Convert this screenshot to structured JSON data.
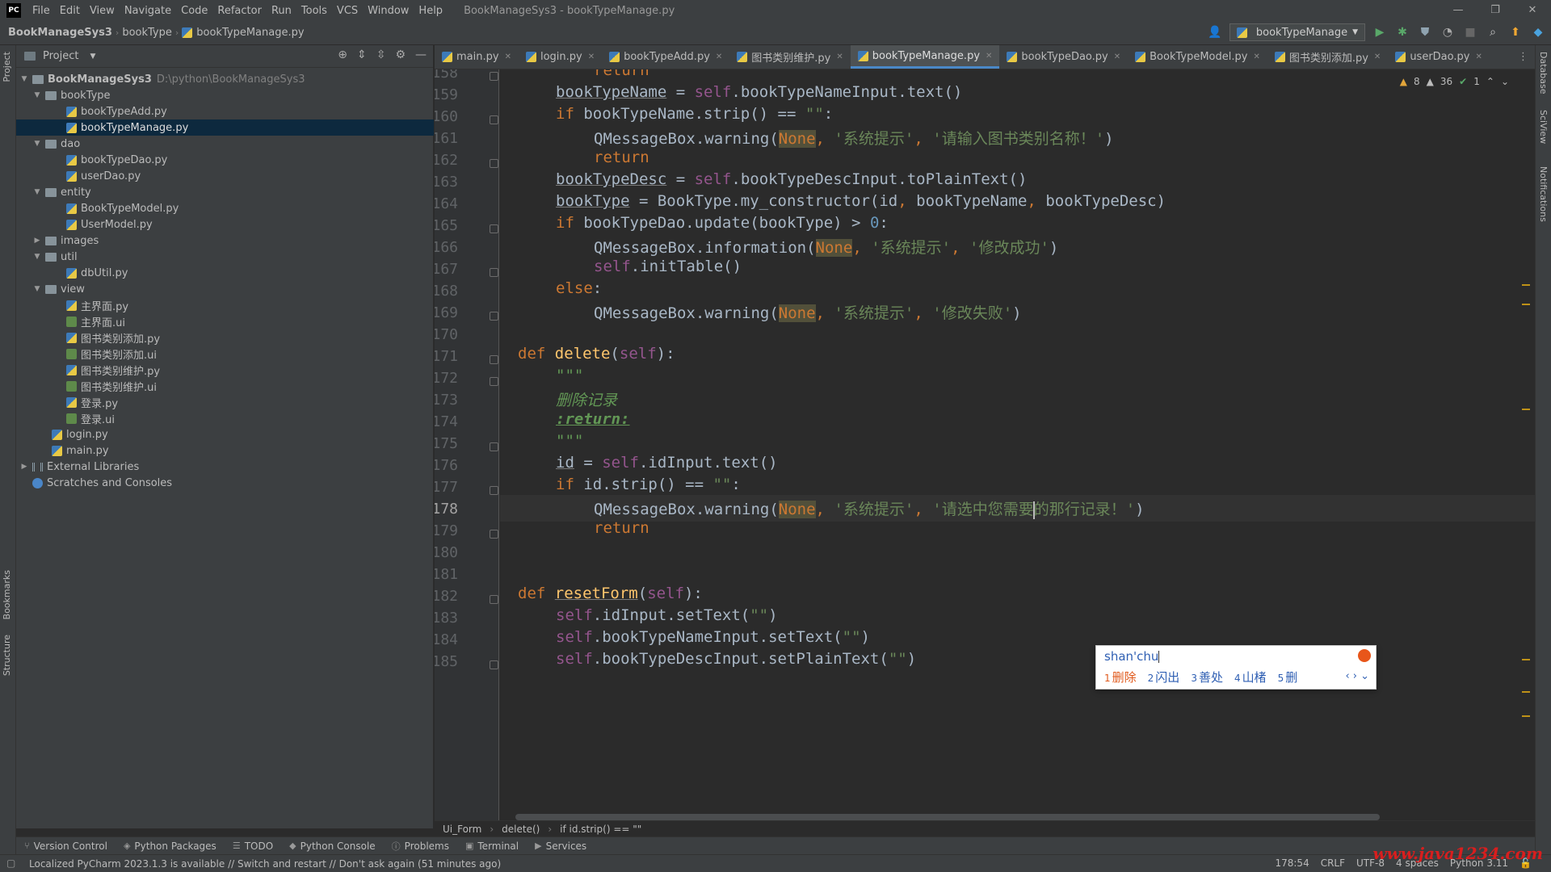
{
  "window": {
    "logo": "PC",
    "title": "BookManageSys3 - bookTypeManage.py",
    "menu": [
      "File",
      "Edit",
      "View",
      "Navigate",
      "Code",
      "Refactor",
      "Run",
      "Tools",
      "VCS",
      "Window",
      "Help"
    ],
    "controls": [
      "—",
      "❐",
      "✕"
    ]
  },
  "breadcrumb": [
    "BookManageSys3",
    "bookType",
    "bookTypeManage.py"
  ],
  "run_config": "bookTypeManage",
  "project_panel": {
    "title": "Project",
    "root_name": "BookManageSys3",
    "root_path": "D:\\python\\BookManageSys3",
    "tree": [
      {
        "label": "bookType",
        "type": "folder",
        "expanded": true
      },
      {
        "label": "bookTypeAdd.py",
        "type": "py"
      },
      {
        "label": "bookTypeManage.py",
        "type": "py",
        "selected": true
      },
      {
        "label": "dao",
        "type": "folder",
        "expanded": true
      },
      {
        "label": "bookTypeDao.py",
        "type": "py"
      },
      {
        "label": "userDao.py",
        "type": "py"
      },
      {
        "label": "entity",
        "type": "folder",
        "expanded": true
      },
      {
        "label": "BookTypeModel.py",
        "type": "py"
      },
      {
        "label": "UserModel.py",
        "type": "py"
      },
      {
        "label": "images",
        "type": "folder",
        "expanded": false
      },
      {
        "label": "util",
        "type": "folder",
        "expanded": true
      },
      {
        "label": "dbUtil.py",
        "type": "py"
      },
      {
        "label": "view",
        "type": "folder",
        "expanded": true
      },
      {
        "label": "主界面.py",
        "type": "py"
      },
      {
        "label": "主界面.ui",
        "type": "ui"
      },
      {
        "label": "图书类别添加.py",
        "type": "py"
      },
      {
        "label": "图书类别添加.ui",
        "type": "ui"
      },
      {
        "label": "图书类别维护.py",
        "type": "py"
      },
      {
        "label": "图书类别维护.ui",
        "type": "ui"
      },
      {
        "label": "登录.py",
        "type": "py"
      },
      {
        "label": "登录.ui",
        "type": "ui"
      },
      {
        "label": "login.py",
        "type": "py"
      },
      {
        "label": "main.py",
        "type": "py"
      },
      {
        "label": "External Libraries",
        "type": "lib"
      },
      {
        "label": "Scratches and Consoles",
        "type": "scratch"
      }
    ]
  },
  "tabs": [
    {
      "label": "main.py"
    },
    {
      "label": "login.py"
    },
    {
      "label": "bookTypeAdd.py"
    },
    {
      "label": "图书类别维护.py"
    },
    {
      "label": "bookTypeManage.py",
      "active": true
    },
    {
      "label": "bookTypeDao.py"
    },
    {
      "label": "BookTypeModel.py"
    },
    {
      "label": "图书类别添加.py"
    },
    {
      "label": "userDao.py"
    }
  ],
  "inspections": {
    "warnings": "8",
    "weak_warnings": "36",
    "ok": "1"
  },
  "editor": {
    "line_numbers": [
      "158",
      "159",
      "160",
      "161",
      "162",
      "163",
      "164",
      "165",
      "166",
      "167",
      "168",
      "169",
      "170",
      "171",
      "172",
      "173",
      "174",
      "175",
      "176",
      "177",
      "178",
      "179",
      "180",
      "181",
      "182",
      "183",
      "184",
      "185"
    ],
    "current_line": "178",
    "strings": {
      "empty": "\"\"",
      "sys_tip": "'系统提示'",
      "input_name": "'请输入图书类别名称！'",
      "modify_ok": "'修改成功'",
      "modify_fail": "'修改失败'",
      "select_a": "'请选中您需要",
      "select_b": "的那行记录！'",
      "triple": "\"\"\"",
      "delete_doc": "删除记录",
      "return_tag": ":return:"
    }
  },
  "ime": {
    "input": "shan'chu",
    "candidates": [
      {
        "idx": "1",
        "text": "删除"
      },
      {
        "idx": "2",
        "text": "闪出"
      },
      {
        "idx": "3",
        "text": "善处"
      },
      {
        "idx": "4",
        "text": "山楮"
      },
      {
        "idx": "5",
        "text": "删"
      }
    ],
    "nav": "‹ › ⌄"
  },
  "editor_breadcrumb": [
    "Ui_Form",
    "delete()",
    "if id.strip() == \"\""
  ],
  "tool_windows": [
    "Version Control",
    "Python Packages",
    "TODO",
    "Python Console",
    "Problems",
    "Terminal",
    "Services"
  ],
  "side_labels": {
    "left_top": "Project",
    "left_bookmarks": "Bookmarks",
    "left_structure": "Structure",
    "right_db": "Database",
    "right_sci": "SciView",
    "right_notif": "Notifications"
  },
  "status": {
    "message": "Localized PyCharm 2023.1.3 is available // Switch and restart // Don't ask again (51 minutes ago)",
    "position": "178:54",
    "line_sep": "CRLF",
    "encoding": "UTF-8",
    "indent": "4 spaces",
    "interpreter": "Python 3.11",
    "watermark": "www.java1234.com"
  }
}
